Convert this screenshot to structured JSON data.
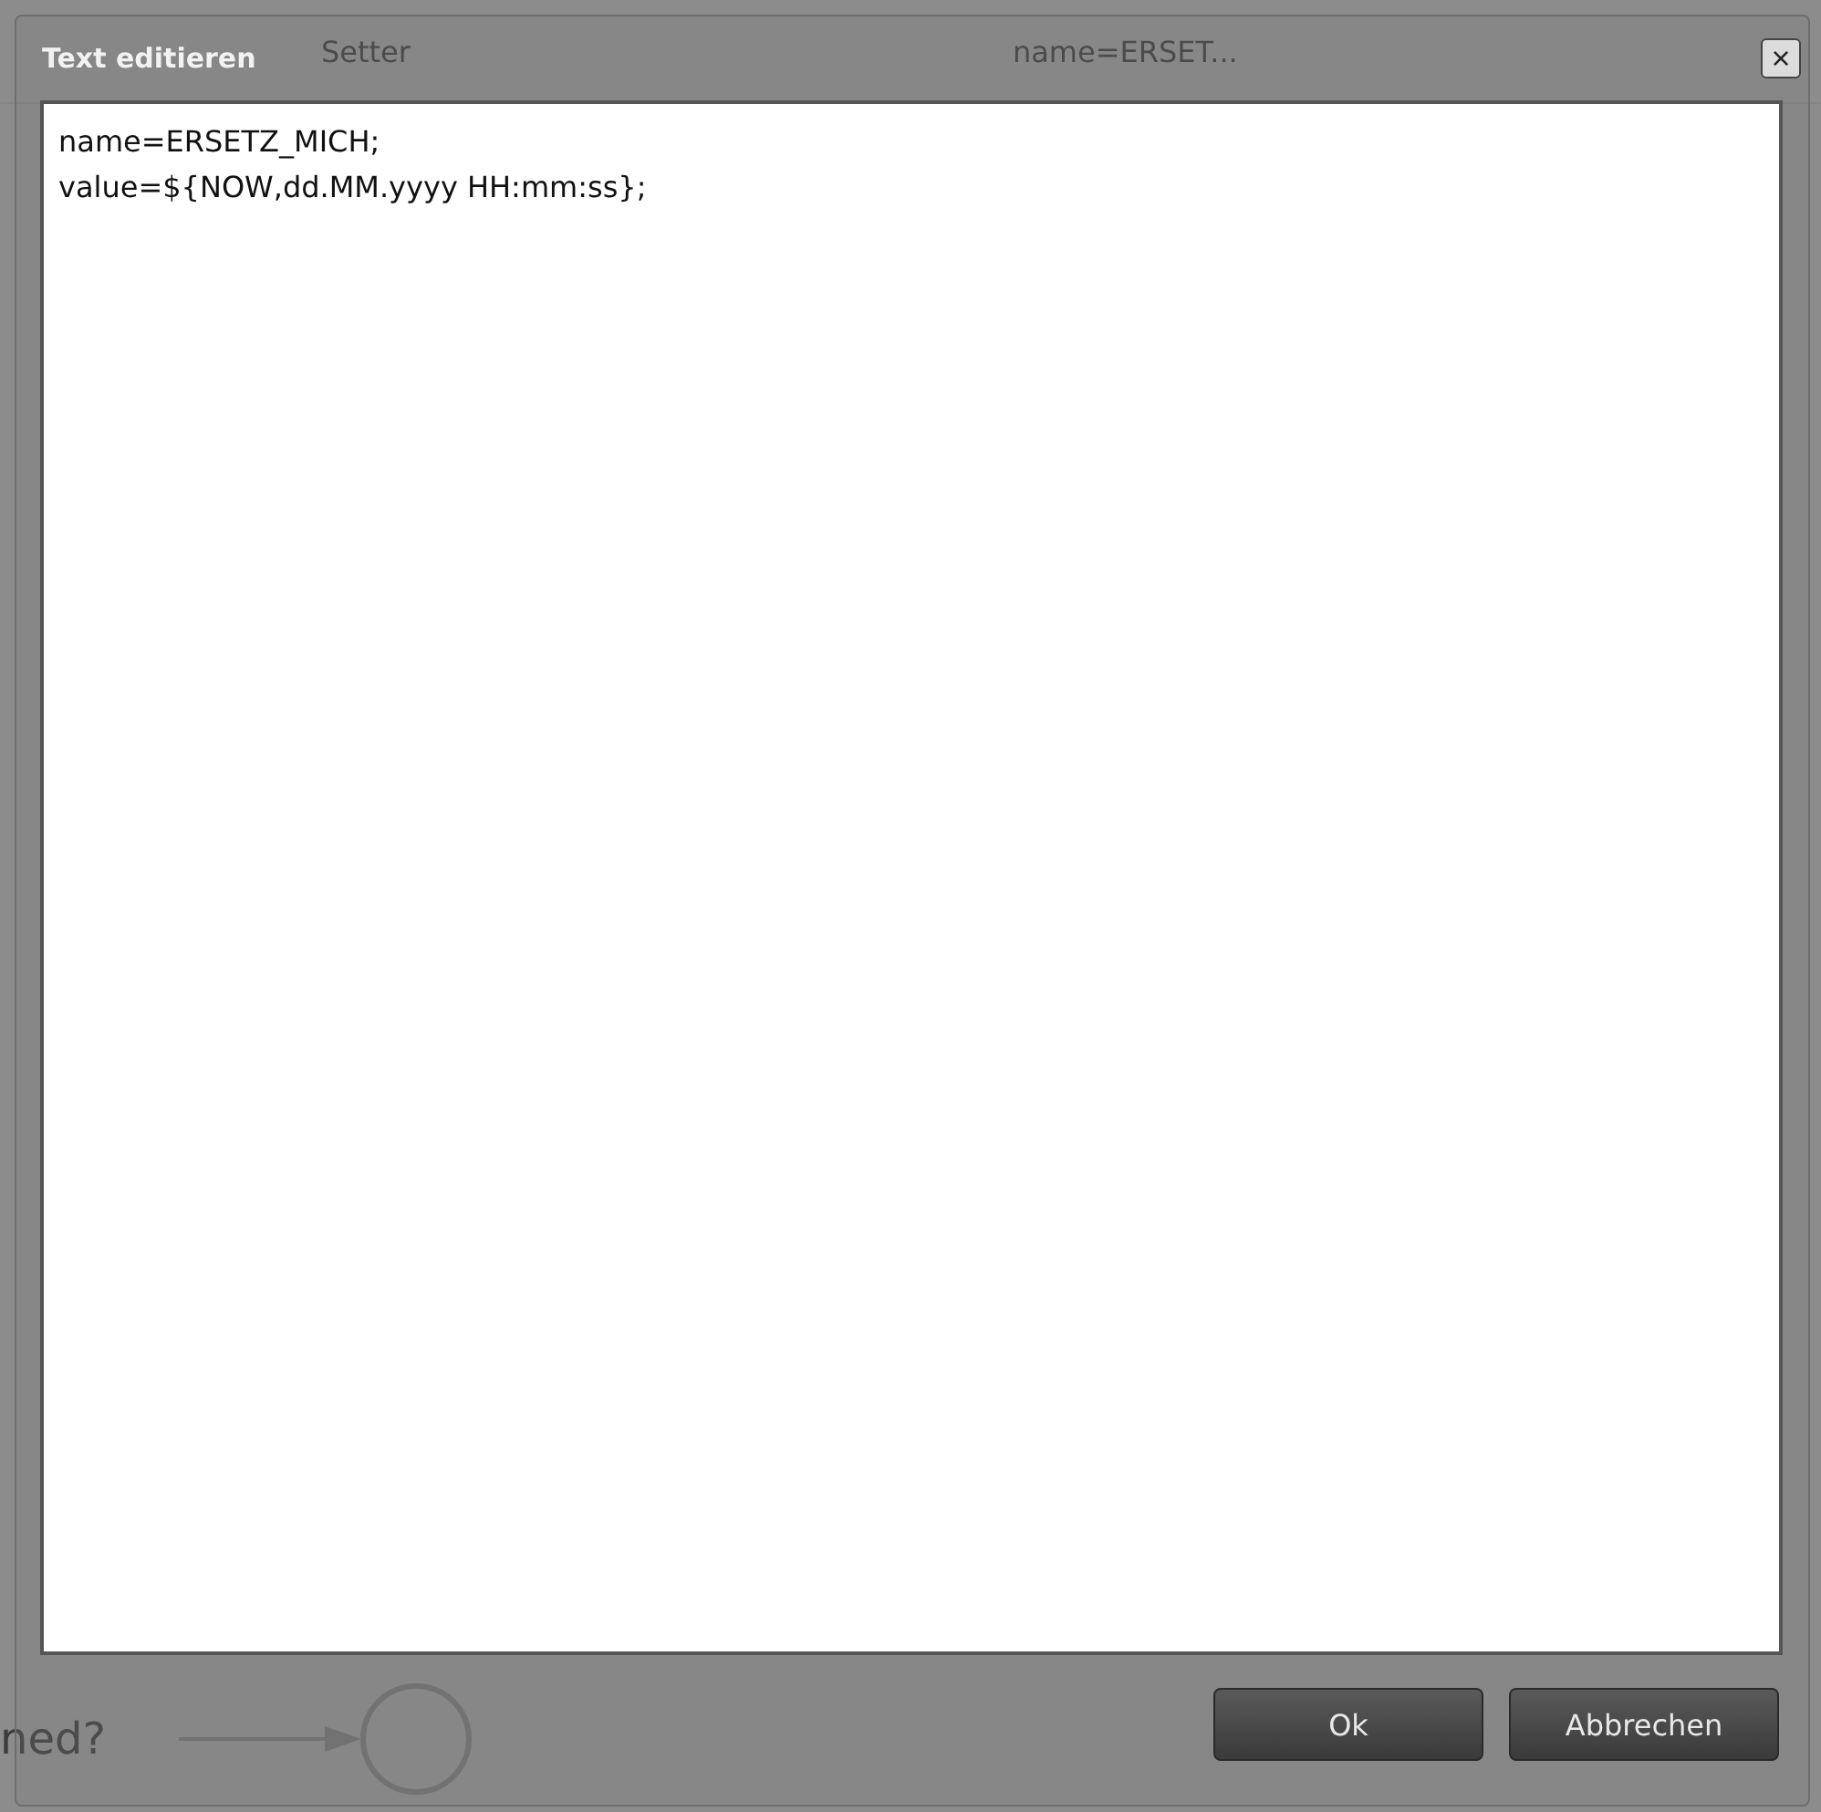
{
  "background": {
    "column_label": "Setter",
    "cell_text": "name=ERSET...",
    "fragment_text": "ned?"
  },
  "dialog": {
    "title": "Text editieren",
    "close_label": "×",
    "text": "name=ERSETZ_MICH;\nvalue=${NOW,dd.MM.yyyy HH:mm:ss};",
    "buttons": [
      {
        "label": "Ok"
      },
      {
        "label": "Abbrechen"
      }
    ]
  }
}
